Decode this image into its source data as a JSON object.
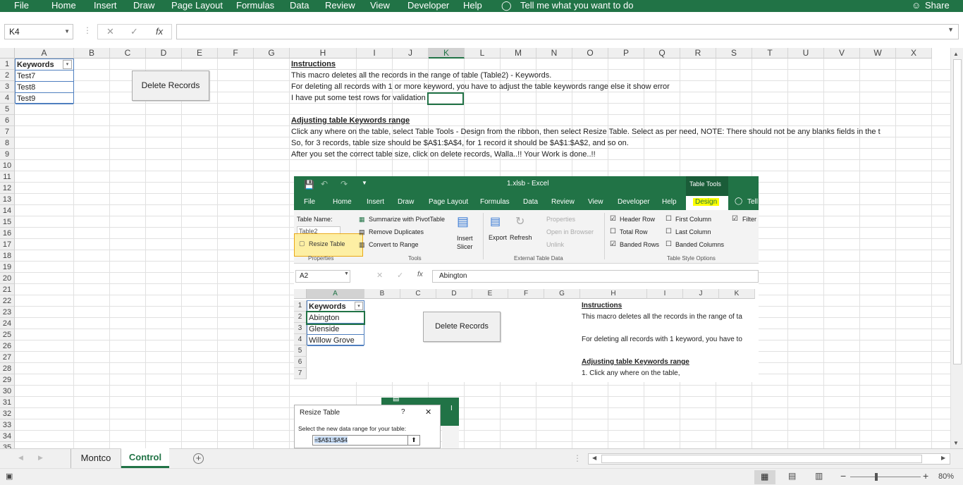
{
  "ribbon": {
    "tabs": [
      "File",
      "Home",
      "Insert",
      "Draw",
      "Page Layout",
      "Formulas",
      "Data",
      "Review",
      "View",
      "Developer",
      "Help"
    ],
    "tell_me": "Tell me what you want to do",
    "share": "Share"
  },
  "formula_bar": {
    "name_box": "K4",
    "fx": "fx",
    "value": ""
  },
  "columns": [
    "A",
    "B",
    "C",
    "D",
    "E",
    "F",
    "G",
    "H",
    "I",
    "J",
    "K",
    "L",
    "M",
    "N",
    "O",
    "P",
    "Q",
    "R",
    "S",
    "T",
    "U",
    "V",
    "W",
    "X"
  ],
  "selected_column": "K",
  "rows": [
    "1",
    "2",
    "3",
    "4",
    "5",
    "6",
    "7",
    "8",
    "9",
    "10",
    "11",
    "12",
    "13",
    "14",
    "15",
    "16",
    "17",
    "18",
    "19",
    "20",
    "21",
    "22",
    "23",
    "24",
    "25",
    "26",
    "27",
    "28",
    "29",
    "30",
    "31",
    "32",
    "33",
    "34",
    "35"
  ],
  "table": {
    "header": "Keywords",
    "rows": [
      "Test7",
      "Test8",
      "Test9"
    ]
  },
  "delete_button": "Delete Records",
  "instructions": {
    "title": "Instructions",
    "line1": "This macro deletes all the records in the range of table (Table2) - Keywords.",
    "line2": "For deleting all records with 1 or more keyword, you have to adjust the table keywords range else it show error",
    "line3": "I have put some test rows for validation",
    "title2": "Adjusting table Keywords range",
    "line4": "Click any where on the table, select Table Tools - Design from the ribbon, then select Resize Table. Select as per need, NOTE: There should not be any blanks fields in the t",
    "line5": "So, for 3 records, table size should be $A$1:$A$4, for 1 record it should be $A$1:$A$2, and so on.",
    "line6": "After you set the correct table size, click on delete records, Walla..!! Your Work is done..!!"
  },
  "screenshot": {
    "title": "1.xlsb - Excel",
    "table_tools": "Table Tools",
    "tabs": [
      "File",
      "Home",
      "Insert",
      "Draw",
      "Page Layout",
      "Formulas",
      "Data",
      "Review",
      "View",
      "Developer",
      "Help",
      "Design",
      "Tell"
    ],
    "table_name_label": "Table Name:",
    "table_name_value": "Table2",
    "resize_table": "Resize Table",
    "properties_group": "Properties",
    "summarize": "Summarize with PivotTable",
    "remove_duplicates": "Remove Duplicates",
    "convert_range": "Convert to Range",
    "tools_group": "Tools",
    "insert_slicer_1": "Insert",
    "insert_slicer_2": "Slicer",
    "export": "Export",
    "refresh": "Refresh",
    "properties": "Properties",
    "open_browser": "Open in Browser",
    "unlink": "Unlink",
    "external_group": "External Table Data",
    "header_row": "Header Row",
    "total_row": "Total Row",
    "banded_rows": "Banded Rows",
    "first_column": "First Column",
    "last_column": "Last Column",
    "banded_columns": "Banded Columns",
    "filter": "Filter",
    "style_group": "Table Style Options",
    "name_box": "A2",
    "fx_value": "Abington",
    "columns": [
      "A",
      "B",
      "C",
      "D",
      "E",
      "F",
      "G",
      "H",
      "I",
      "J",
      "K"
    ],
    "rows": [
      "1",
      "2",
      "3",
      "4",
      "5",
      "6",
      "7"
    ],
    "table_header": "Keywords",
    "table_rows": [
      "Abington",
      "Glenside",
      "Willow Grove"
    ],
    "delete_button": "Delete Records",
    "instr_title": "Instructions",
    "instr_line1": "This macro deletes all the records in the range of ta",
    "instr_line2": "For deleting all records with 1 keyword, you have to",
    "instr_title2": "Adjusting table Keywords range",
    "instr_line3": "1. Click any where on the table,"
  },
  "dialog": {
    "title": "Resize Table",
    "help": "?",
    "close": "✕",
    "prompt": "Select the new data range for your table:",
    "range": "=$A$1:$A$4"
  },
  "sheets": [
    "Montco",
    "Control"
  ],
  "active_sheet": "Control",
  "status": {
    "zoom": "80%"
  },
  "colors": {
    "accent": "#217346",
    "highlight": "#ffff00"
  }
}
